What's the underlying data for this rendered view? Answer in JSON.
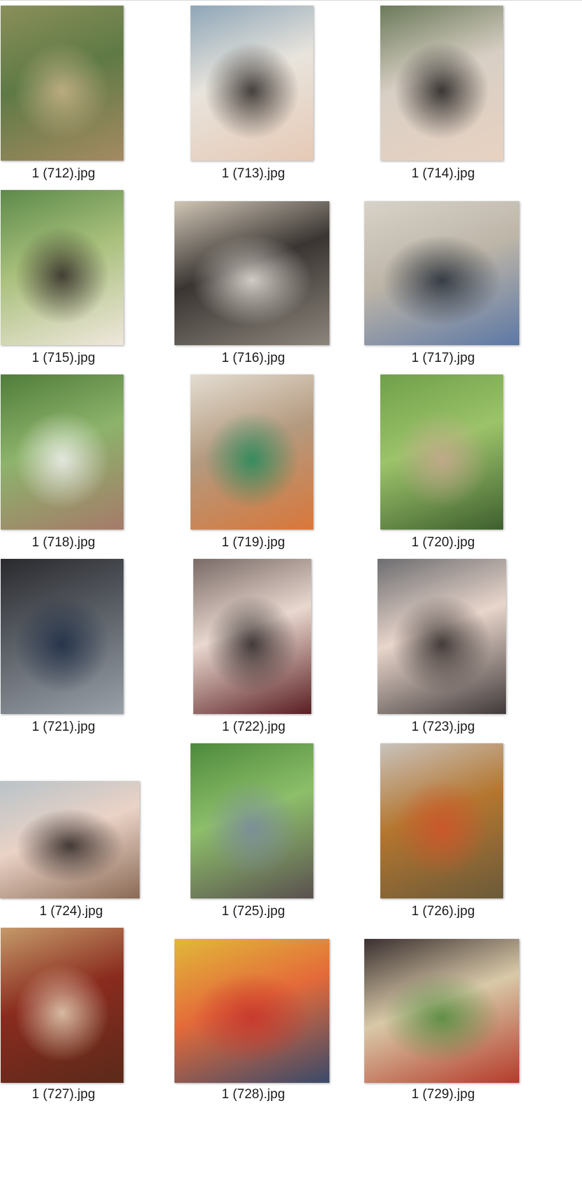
{
  "files": [
    {
      "name": "1 (712).jpg",
      "icon": "meerkats-photo-icon",
      "palette": [
        "#8a8f5a",
        "#5f7a45",
        "#c9b38a",
        "#a58a62"
      ]
    },
    {
      "name": "1 (713).jpg",
      "icon": "couple-selfie-photo-icon",
      "palette": [
        "#8ea6b8",
        "#e8e4dc",
        "#2a2523",
        "#e6c9b6"
      ]
    },
    {
      "name": "1 (714).jpg",
      "icon": "two-women-selfie-photo-icon",
      "palette": [
        "#6b7a5a",
        "#d8cfc4",
        "#1f1c1b",
        "#e8d2c2"
      ]
    },
    {
      "name": "1 (715).jpg",
      "icon": "woman-portrait-park-photo-icon",
      "palette": [
        "#5c8a4a",
        "#a9c07c",
        "#2f2824",
        "#efe7dc"
      ]
    },
    {
      "name": "1 (716).jpg",
      "icon": "car-interior-legs-photo-icon",
      "palette": [
        "#cfc5b5",
        "#3a3532",
        "#e9e4dd",
        "#8c857c"
      ]
    },
    {
      "name": "1 (717).jpg",
      "icon": "car-ceiling-screen-photo-icon",
      "palette": [
        "#d8d2c8",
        "#bdb5a8",
        "#222a35",
        "#5d78a6"
      ]
    },
    {
      "name": "1 (718).jpg",
      "icon": "white-van-photo-icon",
      "palette": [
        "#4f7d3a",
        "#8db36b",
        "#f2f2f2",
        "#a67a6a"
      ]
    },
    {
      "name": "1 (719).jpg",
      "icon": "mahjong-room-photo-icon",
      "palette": [
        "#e4ddd2",
        "#b49a7f",
        "#1f8a5a",
        "#d9773a"
      ]
    },
    {
      "name": "1 (720).jpg",
      "icon": "tree-building-photo-icon",
      "palette": [
        "#6fa04a",
        "#9cc36a",
        "#c8a790",
        "#3e5f2e"
      ]
    },
    {
      "name": "1 (721).jpg",
      "icon": "car-dashboard-photo-icon",
      "palette": [
        "#2a2a2e",
        "#5a5f66",
        "#1c2b44",
        "#9aa0a8"
      ]
    },
    {
      "name": "1 (722).jpg",
      "icon": "woman-car-selfie-photo-icon",
      "palette": [
        "#7a6a66",
        "#e9d8cf",
        "#2a2424",
        "#5a1e22"
      ]
    },
    {
      "name": "1 (723).jpg",
      "icon": "woman-car-portrait-photo-icon",
      "palette": [
        "#6d6d70",
        "#e8d5cb",
        "#2d2726",
        "#403a3a"
      ]
    },
    {
      "name": "1 (724).jpg",
      "icon": "two-women-beach-photo-icon",
      "palette": [
        "#b9c3c8",
        "#ead2c6",
        "#2a2220",
        "#8a6a55"
      ]
    },
    {
      "name": "1 (725).jpg",
      "icon": "street-trees-photo-icon",
      "palette": [
        "#4d8a3c",
        "#8dbf6a",
        "#7a8aa0",
        "#5a5050"
      ]
    },
    {
      "name": "1 (726).jpg",
      "icon": "seafood-table-photo-icon",
      "palette": [
        "#c9c3bd",
        "#b5762f",
        "#d0532a",
        "#6a5a3a"
      ]
    },
    {
      "name": "1 (727).jpg",
      "icon": "roast-goose-photo-icon",
      "palette": [
        "#c59a6a",
        "#8a2b1e",
        "#e6d2b8",
        "#5a2a1a"
      ]
    },
    {
      "name": "1 (728).jpg",
      "icon": "fruit-platter-photo-icon",
      "palette": [
        "#e2b83a",
        "#e46a3a",
        "#c8332a",
        "#3a4a6a"
      ]
    },
    {
      "name": "1 (729).jpg",
      "icon": "dinner-dishes-photo-icon",
      "palette": [
        "#3a3030",
        "#d9c9a8",
        "#4d8a3a",
        "#b53a2a"
      ]
    }
  ]
}
